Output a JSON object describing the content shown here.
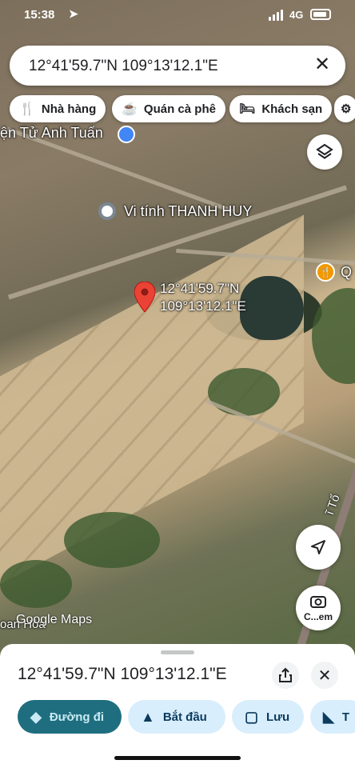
{
  "status_bar": {
    "time": "15:38",
    "network": "4G"
  },
  "search": {
    "value": "12°41'59.7\"N 109°13'12.1\"E"
  },
  "chips": [
    {
      "label": "Nhà hàng",
      "icon": "restaurant-icon"
    },
    {
      "label": "Quán cà phê",
      "icon": "coffee-icon"
    },
    {
      "label": "Khách sạn",
      "icon": "hotel-icon"
    }
  ],
  "map": {
    "labels": {
      "shop_top": "ện Tử Anh Tuấn",
      "vi_tinh": "Vi tính THANH HUY",
      "restaurant_edge": "Q",
      "road_edge": "ĩ Tổ",
      "bottom_left": "oan Hòa"
    },
    "pin_label_line1": "12°41'59.7\"N",
    "pin_label_line2": "109°13'12.1\"E",
    "attribution": "Google Maps",
    "camera_label": "C...em"
  },
  "sheet": {
    "coords": "12°41'59.7\"N 109°13'12.1\"E",
    "actions": [
      {
        "label": "Đường đi",
        "icon": "directions-icon"
      },
      {
        "label": "Bắt đầu",
        "icon": "navigation-icon"
      },
      {
        "label": "Lưu",
        "icon": "bookmark-icon"
      },
      {
        "label": "T",
        "icon": "label-icon"
      }
    ]
  },
  "colors": {
    "pin": "#ea4335",
    "primary_action": "#1f6e7f",
    "secondary_action": "#d9eefc",
    "poi_blue": "#4285f4",
    "poi_orange": "#f29900"
  }
}
